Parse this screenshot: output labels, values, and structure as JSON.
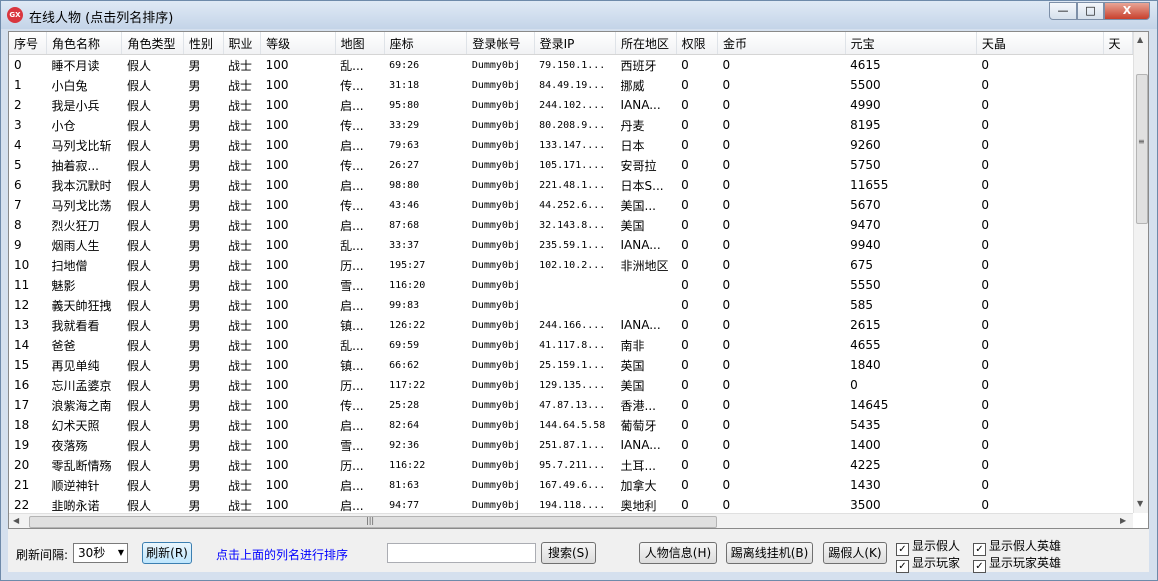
{
  "window": {
    "icon_text": "GX",
    "title": "在线人物 (点击列名排序)",
    "minimize": "—",
    "maximize": "□",
    "close": "X"
  },
  "columns": [
    "序号",
    "角色名称",
    "角色类型",
    "性别",
    "职业",
    "等级",
    "地图",
    "座标",
    "登录帐号",
    "登录IP",
    "所在地区",
    "权限",
    "金币",
    "元宝",
    "天晶",
    "天"
  ],
  "rows": [
    [
      "0",
      "睡不月读",
      "假人",
      "男",
      "战士",
      "100",
      "乱...",
      "69:26",
      "Dummy0bj",
      "79.150.1...",
      "西班牙",
      "0",
      "0",
      "4615",
      "0"
    ],
    [
      "1",
      "小白兔",
      "假人",
      "男",
      "战士",
      "100",
      "传...",
      "31:18",
      "Dummy0bj",
      "84.49.19...",
      "挪威",
      "0",
      "0",
      "5500",
      "0"
    ],
    [
      "2",
      "我是小兵",
      "假人",
      "男",
      "战士",
      "100",
      "启...",
      "95:80",
      "Dummy0bj",
      "244.102....",
      "IANA...",
      "0",
      "0",
      "4990",
      "0"
    ],
    [
      "3",
      "小仓",
      "假人",
      "男",
      "战士",
      "100",
      "传...",
      "33:29",
      "Dummy0bj",
      "80.208.9...",
      "丹麦",
      "0",
      "0",
      "8195",
      "0"
    ],
    [
      "4",
      "马列戈比斩",
      "假人",
      "男",
      "战士",
      "100",
      "启...",
      "79:63",
      "Dummy0bj",
      "133.147....",
      "日本",
      "0",
      "0",
      "9260",
      "0"
    ],
    [
      "5",
      "抽着寂...",
      "假人",
      "男",
      "战士",
      "100",
      "传...",
      "26:27",
      "Dummy0bj",
      "105.171....",
      "安哥拉",
      "0",
      "0",
      "5750",
      "0"
    ],
    [
      "6",
      "我本沉默时",
      "假人",
      "男",
      "战士",
      "100",
      "启...",
      "98:80",
      "Dummy0bj",
      "221.48.1...",
      "日本S...",
      "0",
      "0",
      "11655",
      "0"
    ],
    [
      "7",
      "马列戈比荡",
      "假人",
      "男",
      "战士",
      "100",
      "传...",
      "43:46",
      "Dummy0bj",
      "44.252.6...",
      "美国...",
      "0",
      "0",
      "5670",
      "0"
    ],
    [
      "8",
      "烈火狂刀",
      "假人",
      "男",
      "战士",
      "100",
      "启...",
      "87:68",
      "Dummy0bj",
      "32.143.8...",
      "美国",
      "0",
      "0",
      "9470",
      "0"
    ],
    [
      "9",
      "烟雨人生",
      "假人",
      "男",
      "战士",
      "100",
      "乱...",
      "33:37",
      "Dummy0bj",
      "235.59.1...",
      "IANA...",
      "0",
      "0",
      "9940",
      "0"
    ],
    [
      "10",
      "扫地僧",
      "假人",
      "男",
      "战士",
      "100",
      "历...",
      "195:27",
      "Dummy0bj",
      "102.10.2...",
      "非洲地区",
      "0",
      "0",
      "675",
      "0"
    ],
    [
      "11",
      "魅影",
      "假人",
      "男",
      "战士",
      "100",
      "雪...",
      "116:20",
      "Dummy0bj",
      "",
      "",
      "0",
      "0",
      "5550",
      "0"
    ],
    [
      "12",
      "義天帥狂拽",
      "假人",
      "男",
      "战士",
      "100",
      "启...",
      "99:83",
      "Dummy0bj",
      "",
      "",
      "0",
      "0",
      "585",
      "0"
    ],
    [
      "13",
      "我就看看",
      "假人",
      "男",
      "战士",
      "100",
      "镇...",
      "126:22",
      "Dummy0bj",
      "244.166....",
      "IANA...",
      "0",
      "0",
      "2615",
      "0"
    ],
    [
      "14",
      "爸爸",
      "假人",
      "男",
      "战士",
      "100",
      "乱...",
      "69:59",
      "Dummy0bj",
      "41.117.8...",
      "南非",
      "0",
      "0",
      "4655",
      "0"
    ],
    [
      "15",
      "再见单纯",
      "假人",
      "男",
      "战士",
      "100",
      "镇...",
      "66:62",
      "Dummy0bj",
      "25.159.1...",
      "英国",
      "0",
      "0",
      "1840",
      "0"
    ],
    [
      "16",
      "忘川孟婆京",
      "假人",
      "男",
      "战士",
      "100",
      "历...",
      "117:22",
      "Dummy0bj",
      "129.135....",
      "美国",
      "0",
      "0",
      "0",
      "0"
    ],
    [
      "17",
      "浪紫海之南",
      "假人",
      "男",
      "战士",
      "100",
      "传...",
      "25:28",
      "Dummy0bj",
      "47.87.13...",
      "香港...",
      "0",
      "0",
      "14645",
      "0"
    ],
    [
      "18",
      "幻术天照",
      "假人",
      "男",
      "战士",
      "100",
      "启...",
      "82:64",
      "Dummy0bj",
      "144.64.5.58",
      "葡萄牙",
      "0",
      "0",
      "5435",
      "0"
    ],
    [
      "19",
      "夜落殇",
      "假人",
      "男",
      "战士",
      "100",
      "雪...",
      "92:36",
      "Dummy0bj",
      "251.87.1...",
      "IANA...",
      "0",
      "0",
      "1400",
      "0"
    ],
    [
      "20",
      "零乱断情殇",
      "假人",
      "男",
      "战士",
      "100",
      "历...",
      "116:22",
      "Dummy0bj",
      "95.7.211...",
      "土耳...",
      "0",
      "0",
      "4225",
      "0"
    ],
    [
      "21",
      "顺逆神针",
      "假人",
      "男",
      "战士",
      "100",
      "启...",
      "81:63",
      "Dummy0bj",
      "167.49.6...",
      "加拿大",
      "0",
      "0",
      "1430",
      "0"
    ],
    [
      "22",
      "韭啲永诺",
      "假人",
      "男",
      "战士",
      "100",
      "启...",
      "94:77",
      "Dummy0bj",
      "194.118....",
      "奥地利",
      "0",
      "0",
      "3500",
      "0"
    ]
  ],
  "scroll": {
    "up": "▲",
    "down": "▼",
    "left": "◀",
    "right": "▶",
    "grip": "|||",
    "vgrip": "≡"
  },
  "controls": {
    "refresh_interval_label": "刷新间隔:",
    "refresh_interval_value": "30秒",
    "refresh_button": "刷新(R)",
    "sort_hint": "点击上面的列名进行排序",
    "search_value": "",
    "search_button": "搜索(S)",
    "char_info_button": "人物信息(H)",
    "kick_offline_button": "踢离线挂机(B)",
    "kick_dummy_button": "踢假人(K)",
    "show_dummy": "显示假人",
    "show_players": "显示玩家",
    "show_dummy_hero": "显示假人英雄",
    "show_player_hero": "显示玩家英雄",
    "check_mark": "✓"
  }
}
